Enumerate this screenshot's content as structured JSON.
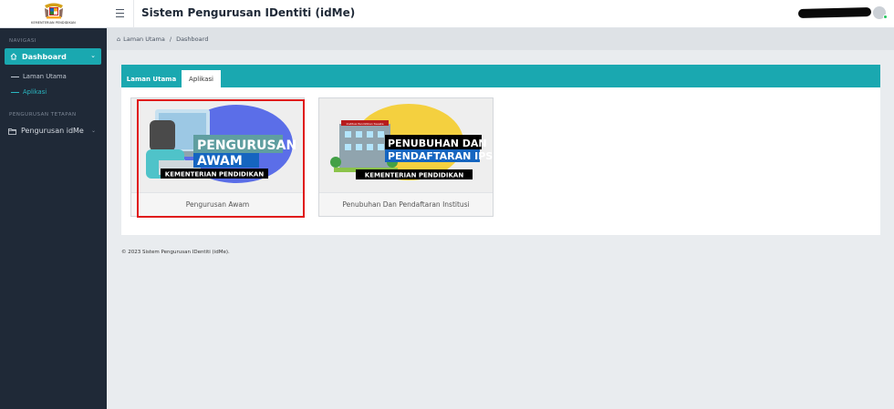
{
  "logo": {
    "text": "KEMENTERIAN PENDIDIKAN"
  },
  "header": {
    "title": "Sistem Pengurusan IDentiti (idMe)"
  },
  "sidebar": {
    "section_navigasi": "NAVIGASI",
    "dashboard_label": "Dashboard",
    "sub_items": [
      "Laman Utama",
      "Aplikasi"
    ],
    "section_pengurusan": "PENGURUSAN TETAPAN",
    "pengurusan_label": "Pengurusan idMe"
  },
  "breadcrumb": {
    "home": "Laman Utama",
    "separator": "/",
    "current": "Dashboard"
  },
  "tabs": [
    "Laman Utama",
    "Aplikasi"
  ],
  "tiles": [
    {
      "caption": "Pengurusan Awam",
      "banner_line1": "PENGURUSAN",
      "banner_line2": "AWAM",
      "banner_sub": "KEMENTERIAN PENDIDIKAN"
    },
    {
      "caption": "Penubuhan Dan Pendaftaran Institusi",
      "banner_line1": "PENUBUHAN DAN",
      "banner_line2": "PENDAFTARAN IPS",
      "banner_sub": "KEMENTERIAN PENDIDIKAN",
      "sign_text": "Institusi Pendidikan Swasta"
    }
  ],
  "footer": "© 2023 Sistem Pengurusan IDentiti (idMe).",
  "colors": {
    "accent": "#1aa8b0",
    "sidebar": "#1f2937",
    "highlight": "#e01b1b"
  },
  "icons": [
    "malaysia-crest",
    "hamburger-icon",
    "home-icon",
    "folder-icon",
    "chevron-down-icon"
  ]
}
